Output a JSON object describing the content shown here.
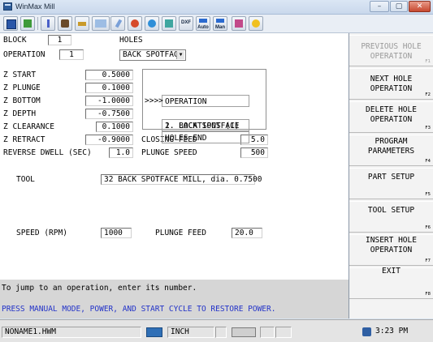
{
  "window": {
    "title": "WinMax Mill",
    "min": "–",
    "max": "▢",
    "close": "✕"
  },
  "toolbar": {
    "dxf_label": "DXF",
    "auto_label": "Auto",
    "man_label": "Man"
  },
  "form": {
    "block_label": "BLOCK",
    "block_value": "1",
    "holes_label": "HOLES",
    "operation_label": "OPERATION",
    "operation_value": "1",
    "operation_type": "BACK SPOTFACE",
    "z_start_label": "Z START",
    "z_start": "0.5000",
    "z_plunge_label": "Z PLUNGE",
    "z_plunge": "0.1000",
    "z_bottom_label": "Z BOTTOM",
    "z_bottom": "-1.0000",
    "z_depth_label": "Z DEPTH",
    "z_depth": "-0.7500",
    "z_clearance_label": "Z CLEARANCE",
    "z_clearance": "0.1000",
    "z_retract_label": "Z RETRACT",
    "z_retract": "-0.9000",
    "reverse_dwell_label": "REVERSE DWELL (SEC)",
    "reverse_dwell": "1.0",
    "closing_feed_label": "CLOSING FEED",
    "closing_feed": "5.0",
    "plunge_speed_label": "PLUNGE SPEED",
    "plunge_speed": "500",
    "tool_label": "TOOL",
    "tool_value": "32 BACK SPOTFACE MILL, dia. 0.7500",
    "speed_label": "SPEED (RPM)",
    "speed_value": "1000",
    "plunge_feed_label": "PLUNGE FEED",
    "plunge_feed": "20.0"
  },
  "operations": {
    "header": "OPERATION",
    "marker": ">>>>",
    "items": [
      "1. BACK SPOTFACE",
      "2. LOCATIONS (1)",
      "HOLES END"
    ]
  },
  "messages": {
    "hint": "To jump to an operation, enter its number.",
    "warning": "PRESS MANUAL MODE, POWER, AND START CYCLE TO RESTORE POWER."
  },
  "fkeys": [
    {
      "label": "PREVIOUS HOLE\nOPERATION",
      "num": "F1"
    },
    {
      "label": "NEXT HOLE\nOPERATION",
      "num": "F2"
    },
    {
      "label": "DELETE HOLE\nOPERATION",
      "num": "F3"
    },
    {
      "label": "PROGRAM\nPARAMETERS",
      "num": "F4"
    },
    {
      "label": "PART SETUP",
      "num": "F5"
    },
    {
      "label": "TOOL SETUP",
      "num": "F6"
    },
    {
      "label": "INSERT HOLE\nOPERATION",
      "num": "F7"
    },
    {
      "label": "EXIT",
      "num": "F8"
    }
  ],
  "status": {
    "filename": "NONAME1.HWM",
    "units": "INCH",
    "time": "3:23 PM"
  }
}
